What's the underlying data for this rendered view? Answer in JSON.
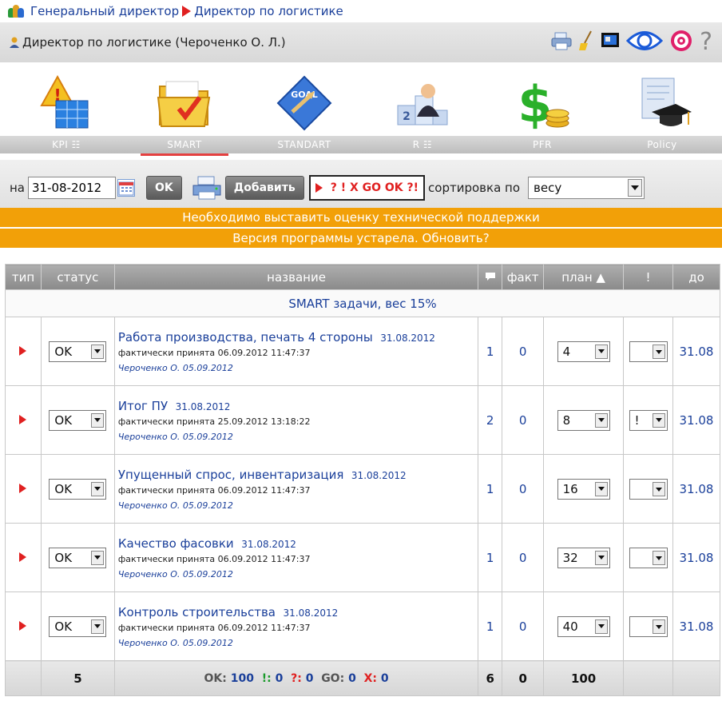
{
  "breadcrumb": {
    "first": "Генеральный директор",
    "second": "Директор по логистике"
  },
  "header": {
    "user_label": "Директор по логистике  (Чероченко О. Л.)",
    "help": "?"
  },
  "nav": [
    {
      "label": "KPI ☷",
      "active": false
    },
    {
      "label": "SMART",
      "active": true
    },
    {
      "label": "STANDART",
      "active": false
    },
    {
      "label": "R ☷",
      "active": false
    },
    {
      "label": "PFR",
      "active": false
    },
    {
      "label": "Policy",
      "active": false
    }
  ],
  "controls": {
    "date_prefix": "на",
    "date_value": "31-08-2012",
    "ok_label": "OK",
    "add_label": "Добавить",
    "status_filter": "? ! X GO OK ?!",
    "sort_label": "сортировка по",
    "sort_value": "весу"
  },
  "notices": [
    "Необходимо выставить оценку технической поддержки",
    "Версия программы устарела. Обновить?"
  ],
  "table": {
    "headers": {
      "type": "тип",
      "status": "статус",
      "name": "название",
      "fact": "факт",
      "plan": "план ▲",
      "excl": "!",
      "due": "до"
    },
    "group_label": "SMART задачи, вес 15%",
    "rows": [
      {
        "status": "OK",
        "title": "Работа производства, печать 4 стороны",
        "date": "31.08.2012",
        "accepted": "фактически принята 06.09.2012 11:47:37",
        "author": "Чероченко О. 05.09.2012",
        "comments": "1",
        "fact": "0",
        "plan": "4",
        "flag": "",
        "due": "31.08"
      },
      {
        "status": "OK",
        "title": "Итог ПУ",
        "date": "31.08.2012",
        "accepted": "фактически принята 25.09.2012 13:18:22",
        "author": "Чероченко О. 05.09.2012",
        "comments": "2",
        "fact": "0",
        "plan": "8",
        "flag": "!",
        "due": "31.08"
      },
      {
        "status": "OK",
        "title": "Упущенный спрос, инвентаризация",
        "date": "31.08.2012",
        "accepted": "фактически принята 06.09.2012 11:47:37",
        "author": "Чероченко О. 05.09.2012",
        "comments": "1",
        "fact": "0",
        "plan": "16",
        "flag": "",
        "due": "31.08"
      },
      {
        "status": "OK",
        "title": "Качество фасовки",
        "date": "31.08.2012",
        "accepted": "фактически принята 06.09.2012 11:47:37",
        "author": "Чероченко О. 05.09.2012",
        "comments": "1",
        "fact": "0",
        "plan": "32",
        "flag": "",
        "due": "31.08"
      },
      {
        "status": "OK",
        "title": "Контроль строительства",
        "date": "31.08.2012",
        "accepted": "фактически принята 06.09.2012 11:47:37",
        "author": "Чероченко О. 05.09.2012",
        "comments": "1",
        "fact": "0",
        "plan": "40",
        "flag": "",
        "due": "31.08"
      }
    ],
    "footer": {
      "count": "5",
      "ok_label": "OK:",
      "ok_value": "100",
      "ex_label": "!:",
      "ex_value": "0",
      "q_label": "?:",
      "q_value": "0",
      "go_label": "GO:",
      "go_value": "0",
      "x_label": "X:",
      "x_value": "0",
      "comments_total": "6",
      "fact_total": "0",
      "plan_total": "100"
    }
  },
  "colors": {
    "accent_orange": "#f2a008",
    "link_blue": "#1a3f9a",
    "marker_red": "#e02020"
  }
}
